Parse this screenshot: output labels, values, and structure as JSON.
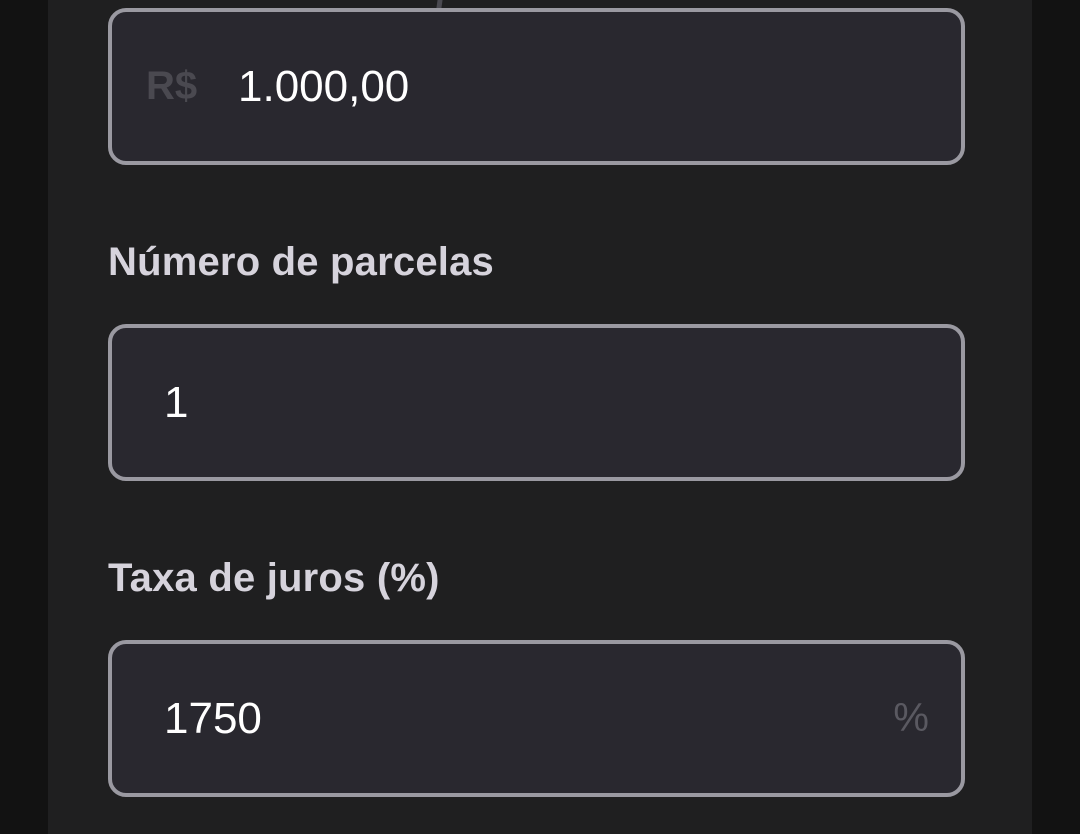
{
  "amount_field": {
    "prefix": "R$",
    "value": "1.000,00"
  },
  "installments_field": {
    "label": "Número de parcelas",
    "value": "1"
  },
  "interest_field": {
    "label": "Taxa de juros (%)",
    "value": "1750",
    "suffix": "%"
  }
}
